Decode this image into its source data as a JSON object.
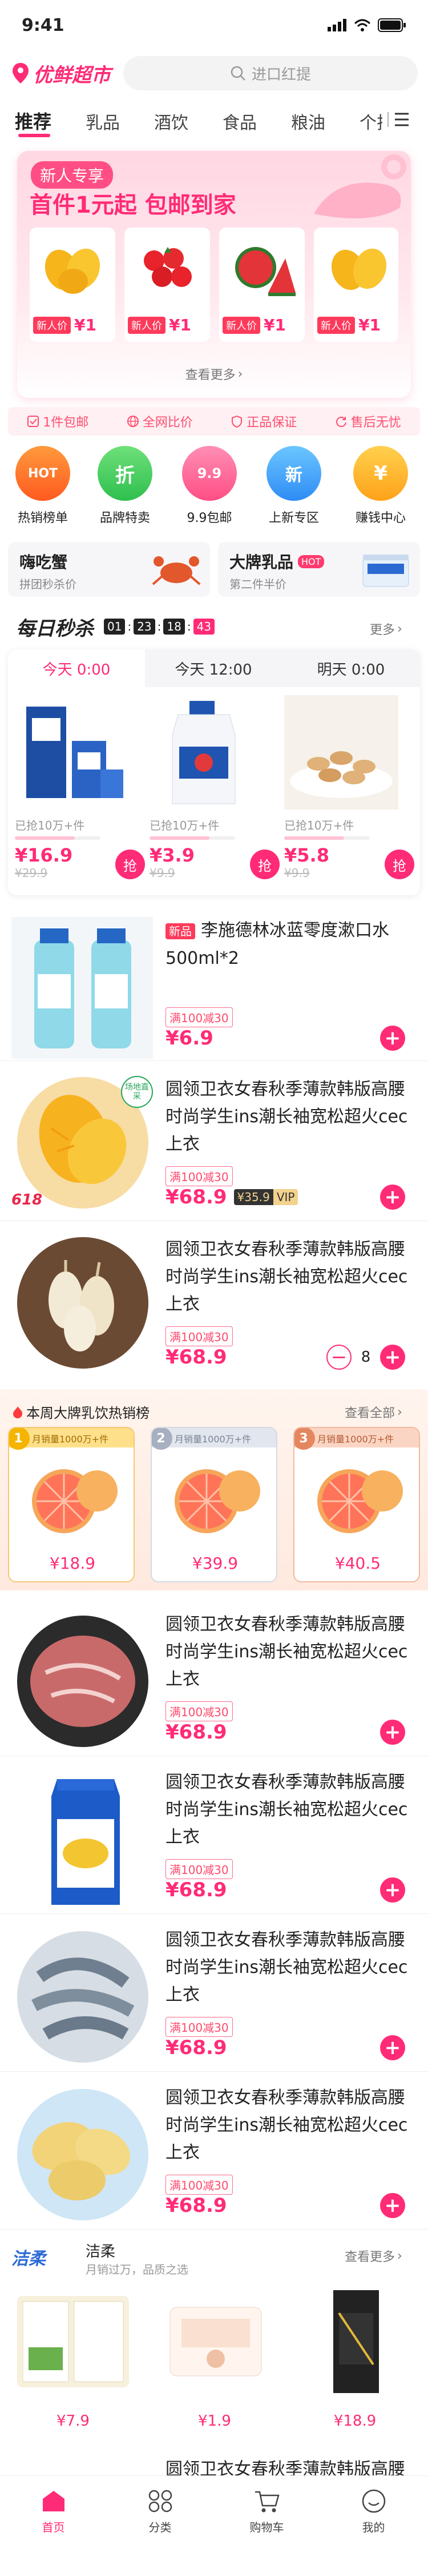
{
  "status_bar": {
    "time": "9:41"
  },
  "header": {
    "app_name": "优鲜超市",
    "search_placeholder": "进口红提"
  },
  "tabs": [
    "推荐",
    "乳品",
    "酒饮",
    "食品",
    "粮油",
    "个护"
  ],
  "new_user": {
    "badge": "新人专享",
    "headline": "首件1元起 包邮到家",
    "products": [
      {
        "tag": "新人价",
        "price": "¥1"
      },
      {
        "tag": "新人价",
        "price": "¥1"
      },
      {
        "tag": "新人价",
        "price": "¥1"
      },
      {
        "tag": "新人价",
        "price": "¥1"
      }
    ],
    "see_more": "查看更多"
  },
  "guarantees": [
    "1件包邮",
    "全网比价",
    "正品保证",
    "售后无忧"
  ],
  "quick_entries": [
    "热销榜单",
    "品牌特卖",
    "9.9包邮",
    "上新专区",
    "赚钱中心"
  ],
  "promo_cards": [
    {
      "title": "嗨吃蟹",
      "subtitle": "拼团秒杀价"
    },
    {
      "title": "大牌乳品",
      "badge": "HOT",
      "subtitle": "第二件半价"
    }
  ],
  "flash_sale": {
    "title": "每日秒杀",
    "countdown": [
      "01",
      "23",
      "18",
      "43"
    ],
    "more": "更多",
    "time_tabs": [
      "今天 0:00",
      "今天 12:00",
      "明天 0:00"
    ],
    "grab_label": "抢",
    "items": [
      {
        "sold": "已抢10万+件",
        "price": "¥16.9",
        "original": "¥29.9"
      },
      {
        "sold": "已抢10万+件",
        "price": "¥3.9",
        "original": "¥9.9"
      },
      {
        "sold": "已抢10万+件",
        "price": "¥5.8",
        "original": "¥9.9"
      }
    ]
  },
  "products": [
    {
      "badge": "新品",
      "title": "李施德林冰蓝零度漱口水500ml*2",
      "promo": "满100减30",
      "price": "¥6.9"
    },
    {
      "corner_label": "618",
      "corner_badge": "场地直采",
      "title": "圆领卫衣女春秋季薄款韩版高腰时尚学生ins潮长袖宽松超火cec上衣",
      "promo": "满100减30",
      "price": "¥68.9",
      "vip_price": "¥35.9",
      "vip_label": "VIP"
    },
    {
      "title": "圆领卫衣女春秋季薄款韩版高腰时尚学生ins潮长袖宽松超火cec上衣",
      "promo": "满100减30",
      "price": "¥68.9",
      "quantity": "8"
    },
    {
      "title": "圆领卫衣女春秋季薄款韩版高腰时尚学生ins潮长袖宽松超火cec上衣",
      "promo": "满100减30",
      "price": "¥68.9"
    },
    {
      "title": "圆领卫衣女春秋季薄款韩版高腰时尚学生ins潮长袖宽松超火cec上衣",
      "promo": "满100减30",
      "price": "¥68.9"
    },
    {
      "title": "圆领卫衣女春秋季薄款韩版高腰时尚学生ins潮长袖宽松超火cec上衣",
      "promo": "满100减30",
      "price": "¥68.9"
    },
    {
      "title": "圆领卫衣女春秋季薄款韩版高腰时尚学生ins潮长袖宽松超火cec上衣",
      "promo": "满100减30",
      "price": "¥68.9"
    },
    {
      "title": "圆领卫衣女春秋季薄款韩版高腰时尚学生ins潮长袖宽松超火cec上衣"
    }
  ],
  "hot_ranking": {
    "title": "本周大牌乳饮热销榜",
    "see_all": "查看全部",
    "items": [
      {
        "rank": "1",
        "sales": "月销量1000万+件",
        "price": "¥18.9"
      },
      {
        "rank": "2",
        "sales": "月销量1000万+件",
        "price": "¥39.9"
      },
      {
        "rank": "3",
        "sales": "月销量1000万+件",
        "price": "¥40.5"
      }
    ]
  },
  "brand": {
    "logo_text": "洁柔",
    "name": "洁柔",
    "slogan": "月销过万，品质之选",
    "see_more": "查看更多",
    "items": [
      {
        "price": "¥7.9"
      },
      {
        "price": "¥1.9"
      },
      {
        "price": "¥18.9"
      }
    ]
  },
  "tab_bar": [
    "首页",
    "分类",
    "购物车",
    "我的"
  ],
  "colors": {
    "accent": "#ff2b76",
    "tag_red": "#fe3a5b",
    "text": "#222222"
  }
}
